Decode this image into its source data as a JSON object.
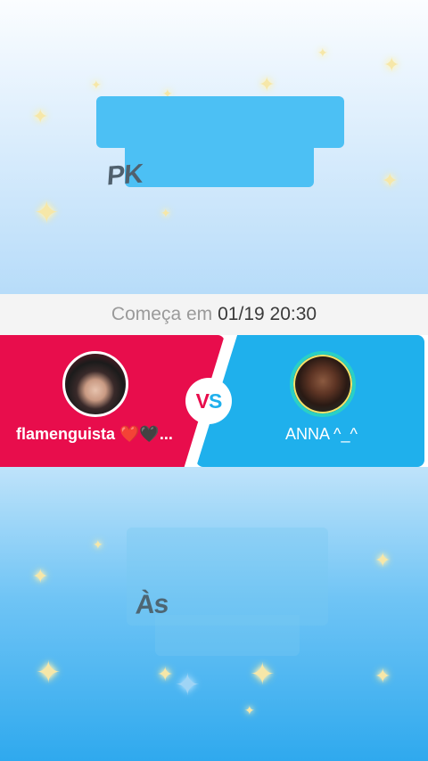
{
  "header": {
    "title": "PK"
  },
  "schedule": {
    "label": "Começa em",
    "time": "01/19 20:30"
  },
  "match": {
    "left_player": {
      "name": "flamenguista ❤️🖤..."
    },
    "vs_v": "V",
    "vs_s": "S",
    "right_player": {
      "name": "ANNA ^_^"
    }
  },
  "footer": {
    "text": "Às"
  },
  "colors": {
    "left_team": "#e80d4c",
    "right_team": "#1fb0ec",
    "vs_background": "#ffffff"
  },
  "icons": {
    "sparkle": "sparkle-icon",
    "avatar_left": "avatar-photo",
    "avatar_right": "avatar-photo"
  }
}
